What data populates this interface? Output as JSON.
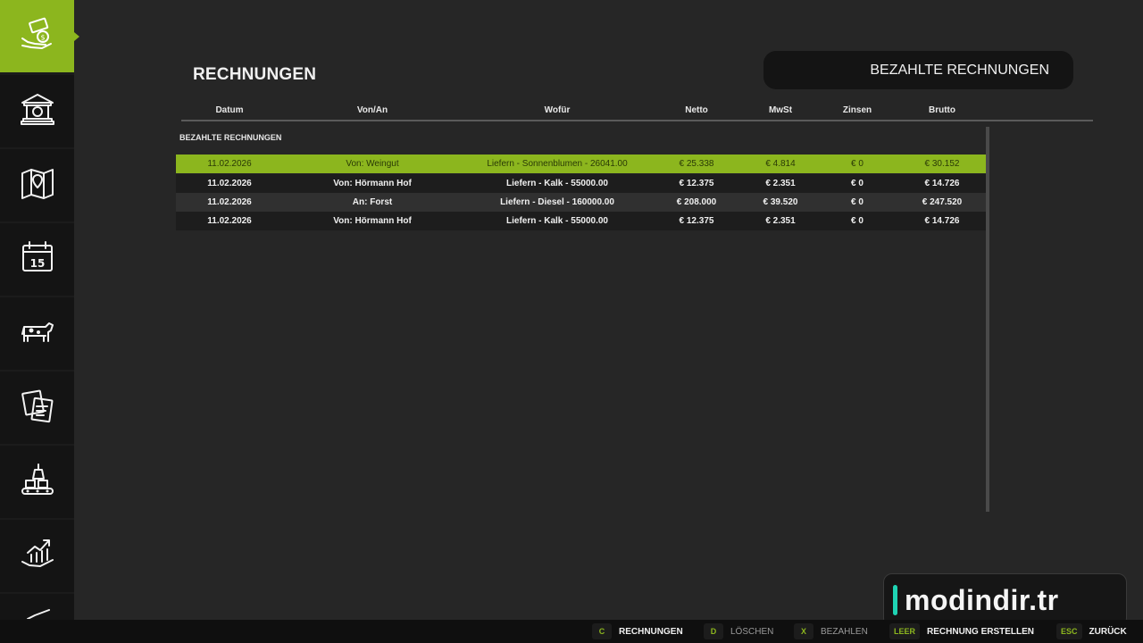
{
  "sidebar": {
    "items": [
      {
        "icon": "money-hand-icon",
        "active": true
      },
      {
        "icon": "bank-icon",
        "active": false
      },
      {
        "icon": "map-icon",
        "active": false
      },
      {
        "icon": "calendar-icon",
        "active": false,
        "badge": "15"
      },
      {
        "icon": "cow-icon",
        "active": false
      },
      {
        "icon": "contracts-icon",
        "active": false
      },
      {
        "icon": "production-icon",
        "active": false
      },
      {
        "icon": "statistics-icon",
        "active": false
      }
    ]
  },
  "header": {
    "title": "RECHNUNGEN",
    "filter": "BEZAHLTE RECHNUNGEN"
  },
  "table": {
    "columns": [
      "Datum",
      "Von/An",
      "Wofür",
      "Netto",
      "MwSt",
      "Zinsen",
      "Brutto"
    ],
    "section": "BEZAHLTE RECHNUNGEN",
    "rows": [
      {
        "date": "11.02.2026",
        "party": "Von: Weingut",
        "item": "Liefern - Sonnenblumen - 26041.00",
        "net": "€ 25.338",
        "vat": "€ 4.814",
        "interest": "€ 0",
        "gross": "€ 30.152"
      },
      {
        "date": "11.02.2026",
        "party": "Von: Hörmann Hof",
        "item": "Liefern - Kalk - 55000.00",
        "net": "€ 12.375",
        "vat": "€ 2.351",
        "interest": "€ 0",
        "gross": "€ 14.726"
      },
      {
        "date": "11.02.2026",
        "party": "An: Forst",
        "item": "Liefern - Diesel - 160000.00",
        "net": "€ 208.000",
        "vat": "€ 39.520",
        "interest": "€ 0",
        "gross": "€ 247.520"
      },
      {
        "date": "11.02.2026",
        "party": "Von: Hörmann Hof",
        "item": "Liefern - Kalk - 55000.00",
        "net": "€ 12.375",
        "vat": "€ 2.351",
        "interest": "€ 0",
        "gross": "€ 14.726"
      }
    ]
  },
  "watermark": "modindir.tr",
  "hints": [
    {
      "key": "C",
      "label": "RECHNUNGEN",
      "dim": false
    },
    {
      "key": "D",
      "label": "LÖSCHEN",
      "dim": true
    },
    {
      "key": "X",
      "label": "BEZAHLEN",
      "dim": true
    },
    {
      "key": "LEER",
      "label": "RECHNUNG ERSTELLEN",
      "dim": false
    },
    {
      "key": "ESC",
      "label": "ZURÜCK",
      "dim": false
    }
  ],
  "colors": {
    "accent": "#8cb61e",
    "background": "#262626",
    "sidebar": "#141414"
  }
}
